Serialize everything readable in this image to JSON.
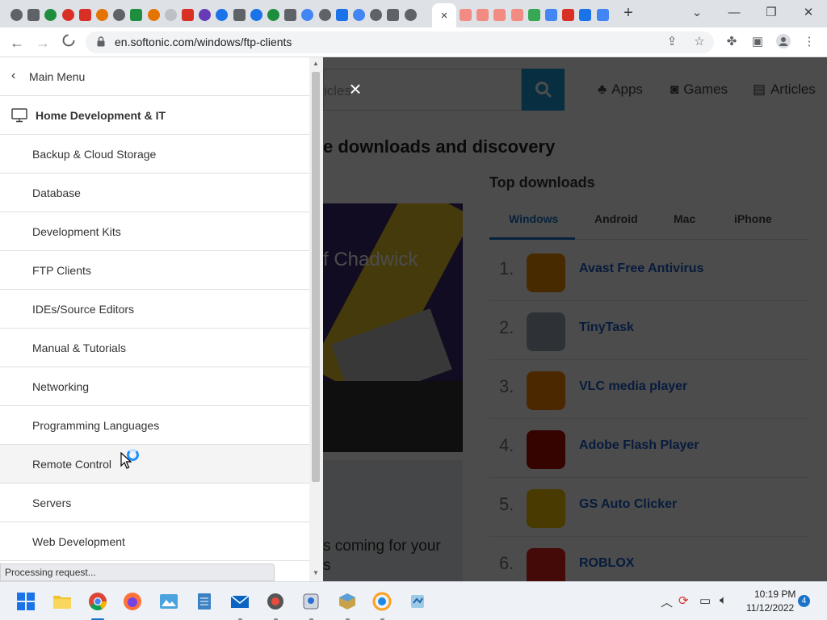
{
  "browser": {
    "url": "en.softonic.com/windows/ftp-clients",
    "tab_colors": [
      "#5f6368",
      "#5f6368",
      "#1e8e3e",
      "#d93025",
      "#d93025",
      "#e37400",
      "#5f6368",
      "#1e8e3e",
      "#e37400",
      "#bdc1c6",
      "#d93025",
      "#673ab7",
      "#1a73e8",
      "#5f6368",
      "#1a73e8",
      "#1e8e3e",
      "#5f6368",
      "#4285f4",
      "#5f6368",
      "#1a73e8",
      "#4285f4",
      "#5f6368",
      "#5f6368",
      "#5f6368"
    ],
    "tab_colors_right": [
      "#f28b82",
      "#f28b82",
      "#f28b82",
      "#f28b82",
      "#34a853",
      "#4285f4",
      "#d93025",
      "#1a73e8",
      "#4285f4"
    ],
    "active_tab_close": "×",
    "new_tab_label": "+"
  },
  "page": {
    "search_placeholder": "icles",
    "nav": {
      "apps": "Apps",
      "games": "Games",
      "articles": "Articles"
    },
    "heading": "e downloads and discovery",
    "hero_caption": "f Chadwick",
    "card2_caption": "s coming for your\ns",
    "top_downloads": {
      "title": "Top downloads",
      "tabs": [
        "Windows",
        "Android",
        "Mac",
        "iPhone"
      ],
      "selected_tab": "Windows",
      "items": [
        {
          "rank": "1.",
          "name": "Avast Free Antivirus",
          "color": "#f28c00"
        },
        {
          "rank": "2.",
          "name": "TinyTask",
          "color": "#9aa7b5"
        },
        {
          "rank": "3.",
          "name": "VLC media player",
          "color": "#ff8800"
        },
        {
          "rank": "4.",
          "name": "Adobe Flash Player",
          "color": "#b30b00"
        },
        {
          "rank": "5.",
          "name": "GS Auto Clicker",
          "color": "#f2c400"
        },
        {
          "rank": "6.",
          "name": "ROBLOX",
          "color": "#e2231a"
        }
      ]
    }
  },
  "menu": {
    "back_label": "Main Menu",
    "category_label": "Home Development & IT",
    "items": [
      "Backup & Cloud Storage",
      "Database",
      "Development Kits",
      "FTP Clients",
      "IDEs/Source Editors",
      "Manual & Tutorials",
      "Networking",
      "Programming Languages",
      "Remote Control",
      "Servers",
      "Web Development"
    ],
    "hovered_item": "Remote Control"
  },
  "status": "Processing request...",
  "taskbar": {
    "time": "10:19 PM",
    "date": "11/12/2022",
    "notifications": "4",
    "apps": [
      "windows-start",
      "file-explorer",
      "chrome",
      "firefox",
      "photos",
      "notepad",
      "mail",
      "app",
      "app",
      "app",
      "app",
      "app"
    ]
  }
}
